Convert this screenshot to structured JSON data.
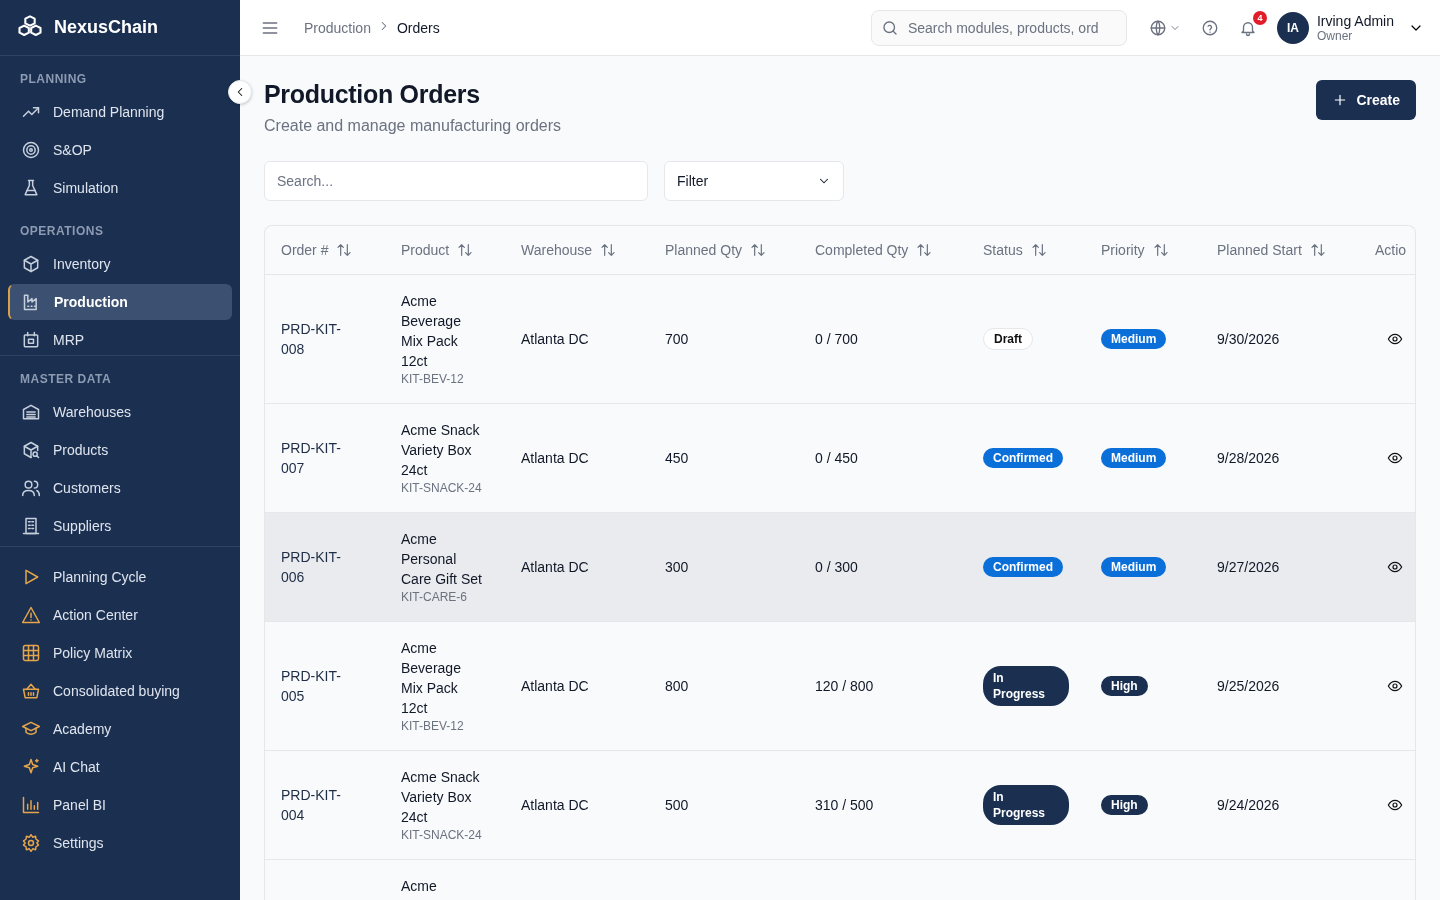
{
  "brand": "NexusChain",
  "sidebar": {
    "sections": [
      {
        "label": "PLANNING",
        "items": [
          {
            "label": "Demand Planning",
            "selected": false
          },
          {
            "label": "S&OP",
            "selected": false
          },
          {
            "label": "Simulation",
            "selected": false
          }
        ]
      },
      {
        "label": "OPERATIONS",
        "items": [
          {
            "label": "Inventory",
            "selected": false
          },
          {
            "label": "Production",
            "selected": true
          },
          {
            "label": "MRP",
            "selected": false
          }
        ]
      },
      {
        "label": "MASTER DATA",
        "items": [
          {
            "label": "Warehouses",
            "selected": false
          },
          {
            "label": "Products",
            "selected": false
          },
          {
            "label": "Customers",
            "selected": false
          },
          {
            "label": "Suppliers",
            "selected": false
          }
        ]
      },
      {
        "items": [
          {
            "label": "Planning Cycle",
            "selected": false
          },
          {
            "label": "Action Center",
            "selected": false
          },
          {
            "label": "Policy Matrix",
            "selected": false
          },
          {
            "label": "Consolidated buying",
            "selected": false
          },
          {
            "label": "Academy",
            "selected": false
          },
          {
            "label": "AI Chat",
            "selected": false
          },
          {
            "label": "Panel BI",
            "selected": false
          },
          {
            "label": "Settings",
            "selected": false
          }
        ]
      }
    ]
  },
  "breadcrumb": [
    "Production",
    "Orders"
  ],
  "topbar": {
    "search": {
      "placeholder": "Search modules, products, ord"
    },
    "notifications": "4",
    "user": {
      "initials": "IA",
      "name": "Irving Admin",
      "role": "Owner"
    }
  },
  "page": {
    "title": "Production Orders",
    "subtitle": "Create and manage manufacturing orders",
    "create_button": "Create",
    "search": {
      "placeholder": "Search..."
    },
    "filter": "Filter"
  },
  "table": {
    "columns": [
      "Order #",
      "Product",
      "Warehouse",
      "Planned Qty",
      "Completed Qty",
      "Status",
      "Priority",
      "Planned Start",
      "Actio"
    ],
    "rows": [
      {
        "order": "PRD-KIT-008",
        "product": "Acme Beverage Mix Pack 12ct",
        "sku": "KIT-BEV-12",
        "warehouse": "Atlanta DC",
        "planned": "700",
        "completed": "0 / 700",
        "status": {
          "label": "Draft",
          "kind": "draft"
        },
        "priority": {
          "label": "Medium",
          "kind": "medium"
        },
        "start": "9/30/2026",
        "selected": false
      },
      {
        "order": "PRD-KIT-007",
        "product": "Acme Snack Variety Box 24ct",
        "sku": "KIT-SNACK-24",
        "warehouse": "Atlanta DC",
        "planned": "450",
        "completed": "0 / 450",
        "status": {
          "label": "Confirmed",
          "kind": "confirmed"
        },
        "priority": {
          "label": "Medium",
          "kind": "medium"
        },
        "start": "9/28/2026",
        "selected": false
      },
      {
        "order": "PRD-KIT-006",
        "product": "Acme Personal Care Gift Set",
        "sku": "KIT-CARE-6",
        "warehouse": "Atlanta DC",
        "planned": "300",
        "completed": "0 / 300",
        "status": {
          "label": "Confirmed",
          "kind": "confirmed"
        },
        "priority": {
          "label": "Medium",
          "kind": "medium"
        },
        "start": "9/27/2026",
        "selected": true
      },
      {
        "order": "PRD-KIT-005",
        "product": "Acme Beverage Mix Pack 12ct",
        "sku": "KIT-BEV-12",
        "warehouse": "Atlanta DC",
        "planned": "800",
        "completed": "120 / 800",
        "status": {
          "label": "In Progress",
          "kind": "in_progress"
        },
        "priority": {
          "label": "High",
          "kind": "high"
        },
        "start": "9/25/2026",
        "selected": false
      },
      {
        "order": "PRD-KIT-004",
        "product": "Acme Snack Variety Box 24ct",
        "sku": "KIT-SNACK-24",
        "warehouse": "Atlanta DC",
        "planned": "500",
        "completed": "310 / 500",
        "status": {
          "label": "In Progress",
          "kind": "in_progress"
        },
        "priority": {
          "label": "High",
          "kind": "high"
        },
        "start": "9/24/2026",
        "selected": false
      },
      {
        "product": "Acme",
        "selected": false
      }
    ]
  }
}
